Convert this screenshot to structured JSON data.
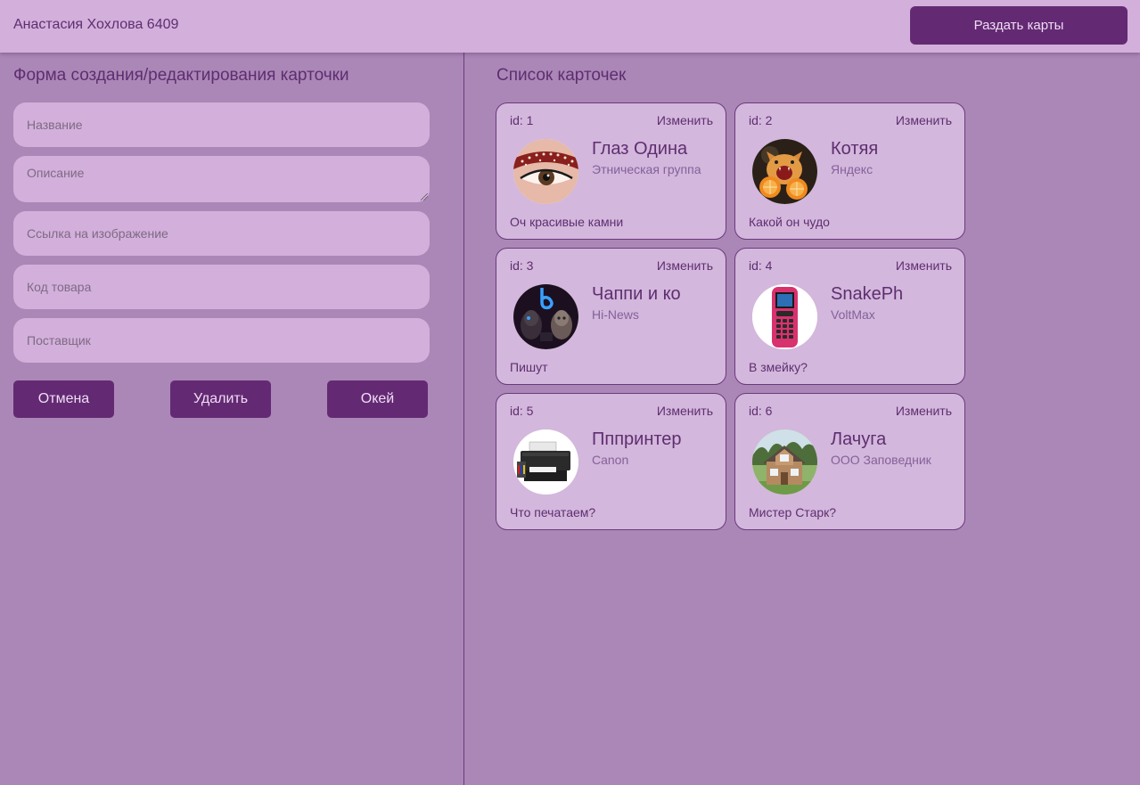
{
  "header": {
    "user": "Анастасия Хохлова 6409",
    "deal_button": "Раздать карты"
  },
  "form": {
    "title": "Форма создания/редактирования карточки",
    "fields": {
      "name": "Название",
      "description": "Описание",
      "image_link": "Ссылка на изображение",
      "product_code": "Код товара",
      "supplier": "Поставщик"
    },
    "buttons": {
      "cancel": "Отмена",
      "delete": "Удалить",
      "ok": "Окей"
    }
  },
  "list": {
    "title": "Список карточек",
    "edit_label": "Изменить",
    "cards": [
      {
        "id": "id: 1",
        "name": "Глаз Одина",
        "group": "Этническая группа",
        "description": "Оч красивые камни",
        "image": "eye-image"
      },
      {
        "id": "id: 2",
        "name": "Котяя",
        "group": "Яндекс",
        "description": "Какой он чудо",
        "image": "kitten-image"
      },
      {
        "id": "id: 3",
        "name": "Чаппи и ко",
        "group": "Hi-News",
        "description": "Пишут",
        "image": "robots-image"
      },
      {
        "id": "id: 4",
        "name": "SnakePh",
        "group": "VoltMax",
        "description": "В змейку?",
        "image": "phone-image"
      },
      {
        "id": "id: 5",
        "name": "Пппринтер",
        "group": "Canon",
        "description": "Что печатаем?",
        "image": "printer-image"
      },
      {
        "id": "id: 6",
        "name": "Лачуга",
        "group": "ООО Заповедник",
        "description": "Мистер Старк?",
        "image": "house-image"
      }
    ]
  },
  "colors": {
    "background": "#ab87b7",
    "topbar": "#d3afdb",
    "accent": "#632a73",
    "card": "#d3b7dc",
    "text": "#5e2e70"
  }
}
